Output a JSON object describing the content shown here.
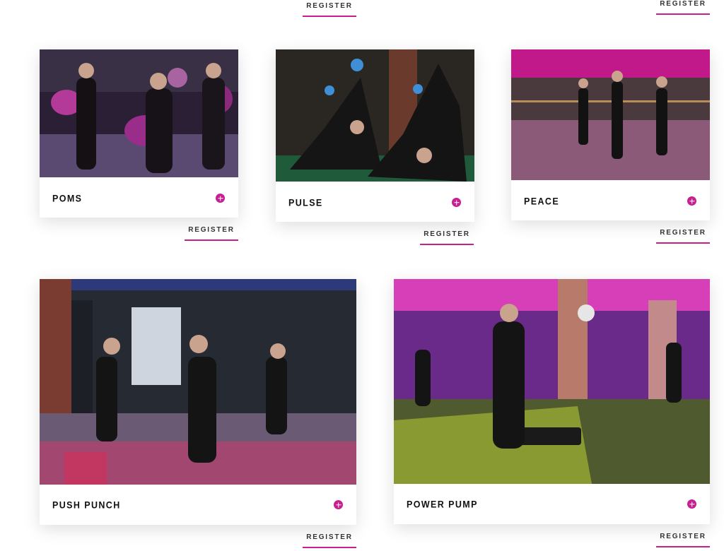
{
  "accent_color": "#c81f8f",
  "register_label": "REGISTER",
  "classes": [
    {
      "title": "POMS",
      "photo": "poms-class-photo"
    },
    {
      "title": "PULSE",
      "photo": "pulse-class-photo"
    },
    {
      "title": "PEACE",
      "photo": "peace-class-photo"
    },
    {
      "title": "PUSH PUNCH",
      "photo": "push-punch-class-photo"
    },
    {
      "title": "POWER PUMP",
      "photo": "power-pump-class-photo"
    }
  ]
}
